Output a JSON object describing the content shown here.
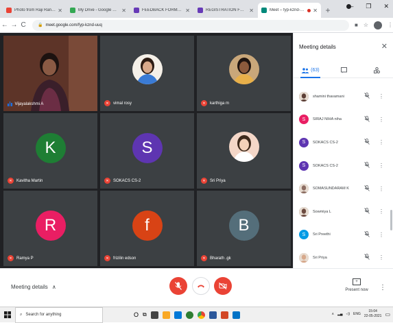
{
  "browser": {
    "tabs": [
      {
        "title": "Photo from Raji Ranjan - Ng",
        "favicon_color": "#ea4335",
        "active": false
      },
      {
        "title": "My Drive - Google Drive",
        "favicon_color": "#34a853",
        "active": false
      },
      {
        "title": "FEEDBACK FORM2023-21-V",
        "favicon_color": "#673ab7",
        "active": false
      },
      {
        "title": "REGISTRATION FORM sri-4",
        "favicon_color": "#673ab7",
        "active": false
      },
      {
        "title": "Meet – fyp-kznd-uuq",
        "favicon_color": "#00897b",
        "active": true
      }
    ],
    "new_tab": "+",
    "url": "meet.google.com/fyp-kznd-uuq",
    "window_controls": {
      "minimize": "–",
      "maximize": "❐",
      "close": "✕"
    }
  },
  "meet": {
    "tiles": [
      {
        "name": "Vijayalakshmi A",
        "type": "video",
        "speaking": true
      },
      {
        "name": "vimal rosy",
        "type": "photo",
        "mic_muted": true,
        "avatar_bg": "#f5f0e8"
      },
      {
        "name": "karthiga m",
        "type": "photo",
        "mic_muted": true,
        "avatar_bg": "#c9a77a"
      },
      {
        "name": "Kavitha Martin",
        "type": "letter",
        "letter": "K",
        "color": "#1e7e34",
        "mic_muted": true
      },
      {
        "name": "SOKACS CS-2",
        "type": "letter",
        "letter": "S",
        "color": "#5e35b1",
        "mic_muted": true
      },
      {
        "name": "Sri Priya",
        "type": "photo",
        "mic_muted": true,
        "avatar_bg": "#f4d7c8"
      },
      {
        "name": "Ramya P",
        "type": "letter",
        "letter": "R",
        "color": "#e91e63",
        "mic_muted": true
      },
      {
        "name": "frizilin edson",
        "type": "letter",
        "letter": "f",
        "color": "#d84315",
        "mic_muted": true
      },
      {
        "name": "Bharath .gk",
        "type": "letter",
        "letter": "B",
        "color": "#546e7a",
        "mic_muted": true
      }
    ],
    "controls": {
      "meeting_details": "Meeting details",
      "present_now": "Present now",
      "mic_state": "off",
      "camera_state": "off"
    }
  },
  "panel": {
    "title": "Meeting details",
    "people_count": "(63)",
    "participants": [
      {
        "name": "shamini thavamani",
        "avatar": "photo",
        "color": "#5d4037"
      },
      {
        "name": "SIRAJ NIHA niha",
        "avatar": "letter",
        "letter": "S",
        "color": "#e91e63"
      },
      {
        "name": "SOKACS CS-2",
        "avatar": "letter",
        "letter": "S",
        "color": "#5e35b1"
      },
      {
        "name": "SOKACS CS-2",
        "avatar": "letter",
        "letter": "S",
        "color": "#5e35b1"
      },
      {
        "name": "SOMASUNDARAM K",
        "avatar": "photo",
        "color": "#8d6e63"
      },
      {
        "name": "Sowmiya L",
        "avatar": "photo",
        "color": "#6d4c41"
      },
      {
        "name": "Sri Preethi",
        "avatar": "letter",
        "letter": "S",
        "color": "#039be5"
      },
      {
        "name": "Sri Priya",
        "avatar": "photo",
        "color": "#d7a98c"
      }
    ]
  },
  "taskbar": {
    "search_placeholder": "Search for anything",
    "lang": "ENG",
    "time": "15:04",
    "date": "22-05-2021"
  }
}
